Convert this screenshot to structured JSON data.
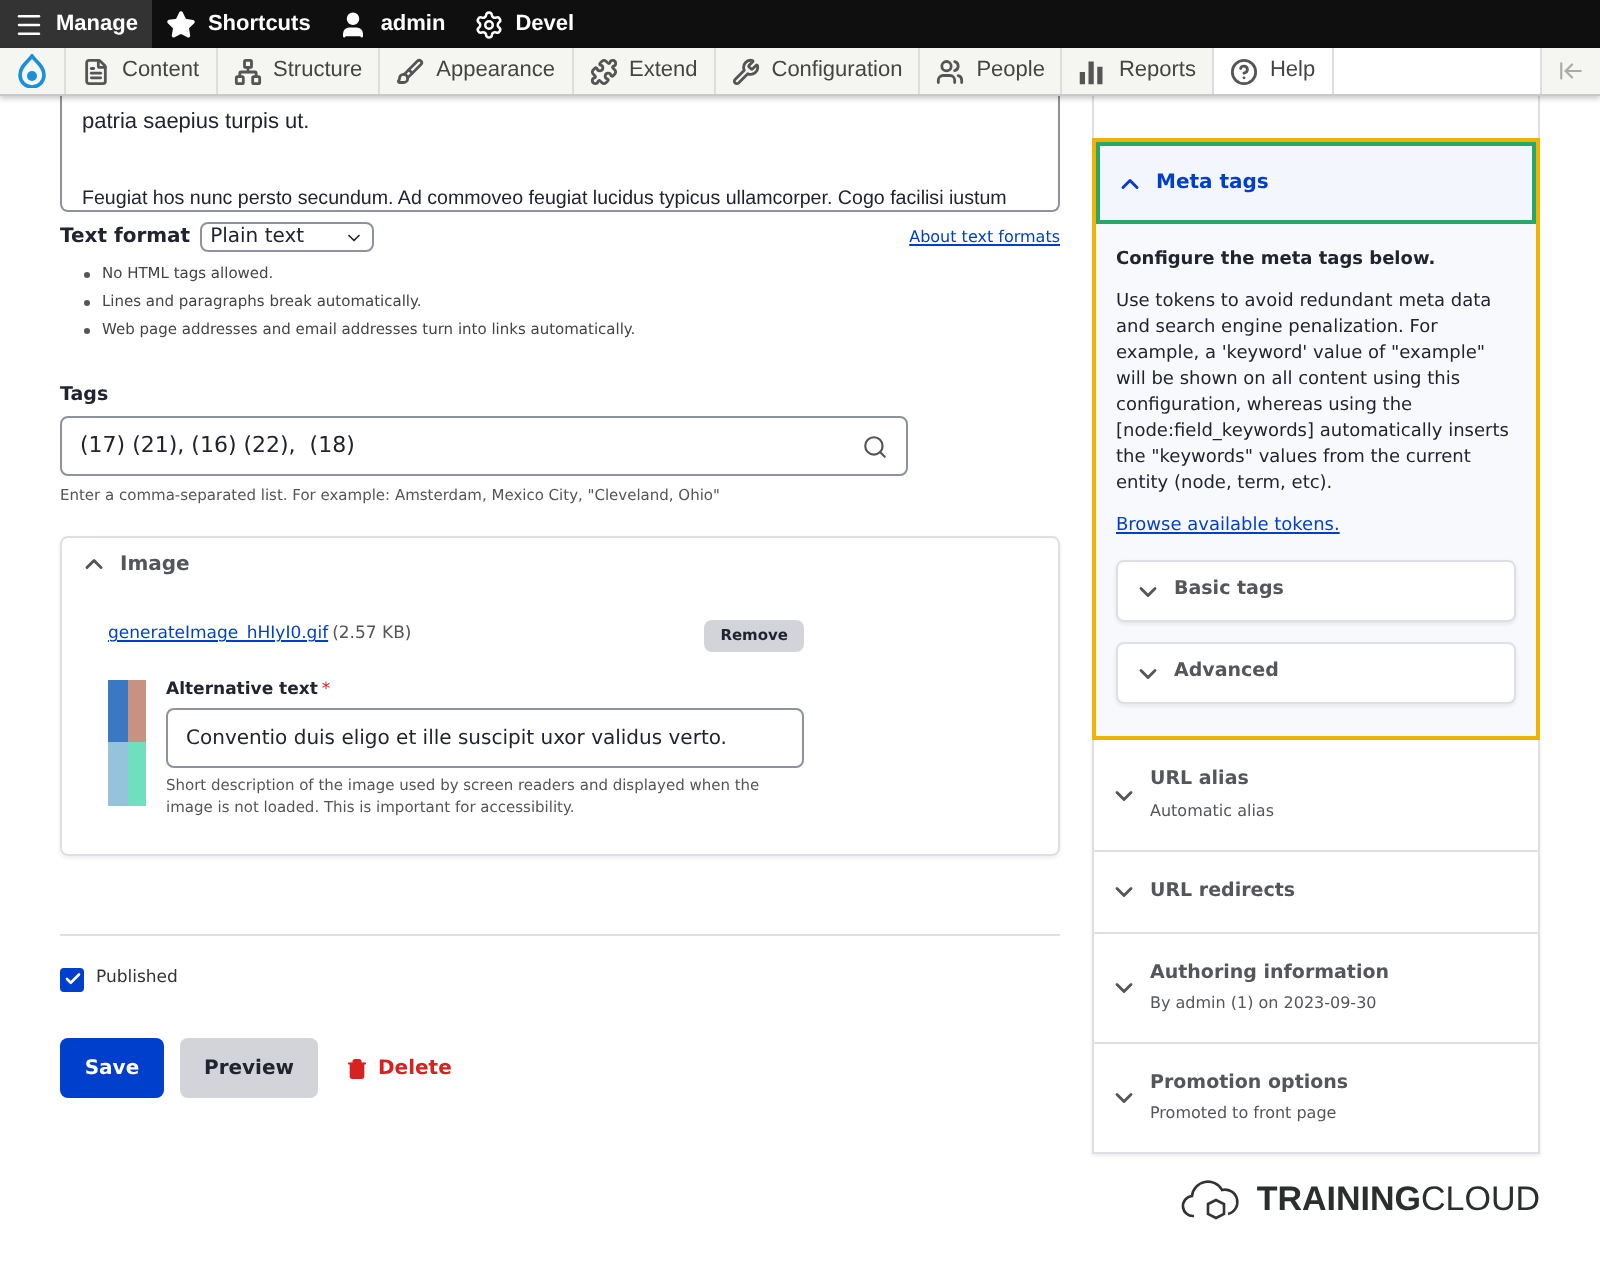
{
  "toolbar": {
    "items": [
      {
        "label": "Manage",
        "selected": true
      },
      {
        "label": "Shortcuts",
        "selected": false
      },
      {
        "label": "admin",
        "selected": false
      },
      {
        "label": "Devel",
        "selected": false
      }
    ]
  },
  "menu": {
    "items": [
      {
        "label": "Content",
        "selected": false
      },
      {
        "label": "Structure",
        "selected": false
      },
      {
        "label": "Appearance",
        "selected": false
      },
      {
        "label": "Extend",
        "selected": false
      },
      {
        "label": "Configuration",
        "selected": false
      },
      {
        "label": "People",
        "selected": false
      },
      {
        "label": "Reports",
        "selected": false
      },
      {
        "label": "Help",
        "selected": true
      }
    ]
  },
  "body": {
    "lines": [
      "patria saepius turpis ut.",
      "Feugiat hos nunc persto secundum. Ad commoveo feugiat lucidus typicus ullamcorper. Cogo facilisi iustum"
    ]
  },
  "text_format": {
    "label": "Text format",
    "value": "Plain text",
    "link": "About text formats",
    "tips": [
      "No HTML tags allowed.",
      "Lines and paragraphs break automatically.",
      "Web page addresses and email addresses turn into links automatically."
    ]
  },
  "tags": {
    "label": "Tags",
    "value": "(17) (21), (16) (22),  (18)",
    "description": "Enter a comma-separated list. For example: Amsterdam, Mexico City, \"Cleveland, Ohio\""
  },
  "image": {
    "title": "Image",
    "expanded": true,
    "file_name": "generateImage_hHIyI0.gif",
    "file_size": "(2.57 KB)",
    "remove": "Remove",
    "alt_label": "Alternative text",
    "required_mark": "*",
    "alt_value": "Conventio duis eligo et ille suscipit uxor validus verto.",
    "alt_description": "Short description of the image used by screen readers and displayed when the image is not loaded. This is important for accessibility."
  },
  "published": {
    "label": "Published",
    "checked": true
  },
  "actions": {
    "save": "Save",
    "preview": "Preview",
    "delete": "Delete"
  },
  "sidebar": {
    "meta_tags": {
      "title": "Meta tags",
      "expanded": true,
      "heading": "Configure the meta tags below.",
      "text": "Use tokens to avoid redundant meta data and search engine penalization. For example, a 'keyword' value of \"example\" will be shown on all content using this configuration, whereas using the [node:field_keywords] automatically inserts the \"keywords\" values from the current entity (node, term, etc).",
      "link": "Browse available tokens.",
      "groups": [
        {
          "title": "Basic tags",
          "expanded": false
        },
        {
          "title": "Advanced",
          "expanded": false
        }
      ]
    },
    "sections": [
      {
        "title": "URL alias",
        "summary": "Automatic alias",
        "expanded": false
      },
      {
        "title": "URL redirects",
        "expanded": false
      },
      {
        "title": "Authoring information",
        "summary": "By admin (1) on 2023-09-30",
        "expanded": false
      },
      {
        "title": "Promotion options",
        "summary": "Promoted to front page",
        "expanded": false
      }
    ]
  },
  "brand": {
    "bold": "TRAINING",
    "light": "CLOUD"
  }
}
